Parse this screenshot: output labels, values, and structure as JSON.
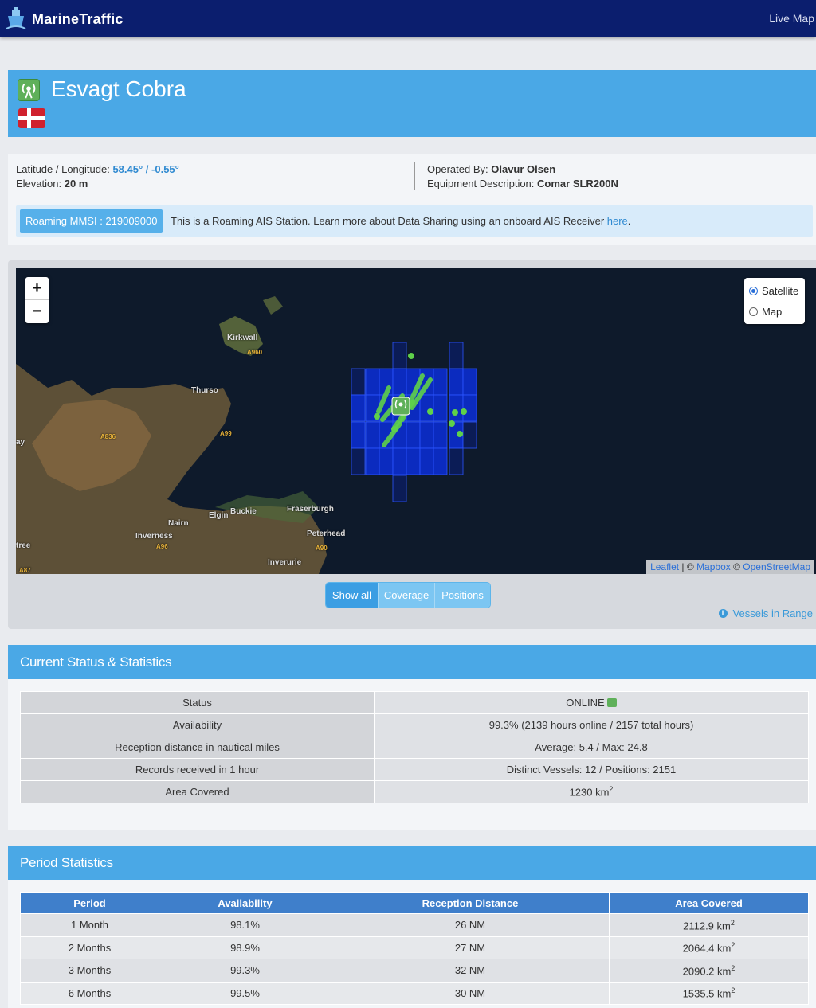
{
  "nav": {
    "brand": "MarineTraffic",
    "live_map": "Live Map"
  },
  "station": {
    "name": "Esvagt Cobra",
    "flag": "Denmark",
    "lat_lon_label": "Latitude / Longitude:",
    "lat_lon_value": "58.45° / -0.55°",
    "elevation_label": "Elevation:",
    "elevation_value": "20 m",
    "operated_by_label": "Operated By:",
    "operated_by_value": "Olavur Olsen",
    "equipment_label": "Equipment Description:",
    "equipment_value": "Comar SLR200N",
    "roaming_badge": "Roaming MMSI : 219009000",
    "roaming_text": "This is a Roaming AIS Station. Learn more about Data Sharing using an onboard AIS Receiver ",
    "roaming_link": "here",
    "roaming_period": "."
  },
  "map": {
    "zoom_in": "+",
    "zoom_out": "−",
    "layers": {
      "satellite": "Satellite",
      "map": "Map",
      "selected": "Satellite"
    },
    "attribution": {
      "leaflet": "Leaflet",
      "sep": " | © ",
      "mapbox": "Mapbox",
      "sep2": " © ",
      "osm": "OpenStreetMap"
    },
    "labels": {
      "kirkwall": "Kirkwall",
      "a960": "A960",
      "thurso": "Thurso",
      "a836": "A836",
      "a99": "A99",
      "elgin": "Elgin",
      "buckie": "Buckie",
      "fraserburgh": "Fraserburgh",
      "nairn": "Nairn",
      "inverness": "Inverness",
      "a96": "A96",
      "peterhead": "Peterhead",
      "a90": "A90",
      "inverurie": "Inverurie",
      "a87": "A87",
      "tree": "tree",
      "ay": "ay"
    },
    "buttons": {
      "show_all": "Show all",
      "coverage": "Coverage",
      "positions": "Positions"
    },
    "vessels_in_range": "Vessels in Range",
    "colors": {
      "coverage": "#0a2fd9",
      "positions": "#5fd14a",
      "sea": "#0e1a2b",
      "land": "#6b5a3a"
    }
  },
  "status": {
    "header": "Current Status & Statistics",
    "rows": [
      {
        "key": "Status",
        "value": "ONLINE"
      },
      {
        "key": "Availability",
        "value": "99.3% (2139 hours online / 2157 total hours)"
      },
      {
        "key": "Reception distance in nautical miles",
        "value": "Average: 5.4 / Max: 24.8"
      },
      {
        "key": "Records received in 1 hour",
        "value": "Distinct Vessels: 12 / Positions: 2151"
      },
      {
        "key": "Area Covered",
        "value": "1230 km",
        "sup": "2"
      }
    ]
  },
  "period": {
    "header": "Period Statistics",
    "columns": [
      "Period",
      "Availability",
      "Reception Distance",
      "Area Covered"
    ],
    "rows": [
      [
        "1 Month",
        "98.1%",
        "26 NM",
        "2112.9 km"
      ],
      [
        "2 Months",
        "98.9%",
        "27 NM",
        "2064.4 km"
      ],
      [
        "3 Months",
        "99.3%",
        "32 NM",
        "2090.2 km"
      ],
      [
        "6 Months",
        "99.5%",
        "30 NM",
        "1535.5 km"
      ]
    ],
    "area_unit_sup": "2"
  }
}
